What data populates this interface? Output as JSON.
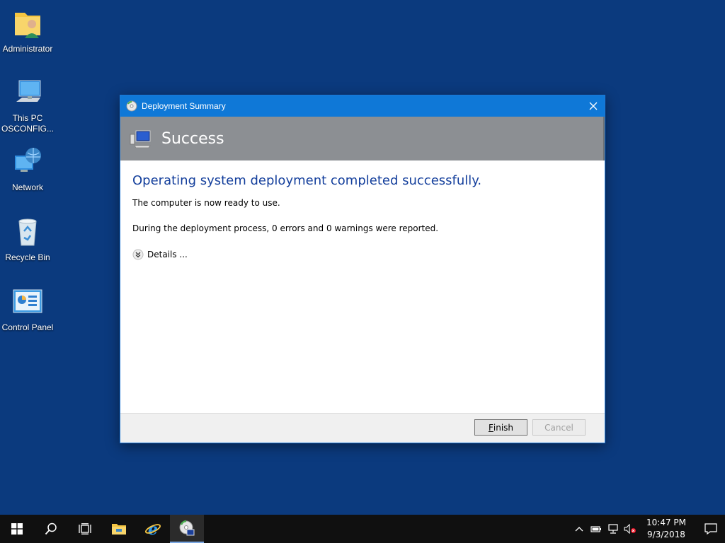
{
  "desktop": {
    "icons": [
      {
        "label": "Administrator",
        "icon": "user-folder-icon"
      },
      {
        "label": "This PC\nOSCONFIG...",
        "icon": "this-pc-icon"
      },
      {
        "label": "Network",
        "icon": "network-icon"
      },
      {
        "label": "Recycle Bin",
        "icon": "recycle-bin-icon"
      },
      {
        "label": "Control Panel",
        "icon": "control-panel-icon"
      }
    ]
  },
  "dialog": {
    "title": "Deployment Summary",
    "header": "Success",
    "headline": "Operating system deployment completed successfully.",
    "ready_text": "The computer is now ready to use.",
    "summary_text": "During the deployment process, 0 errors and 0 warnings were reported.",
    "details_label": "Details ...",
    "finish_label_underlined": "F",
    "finish_label_rest": "inish",
    "cancel_label": "Cancel",
    "colors": {
      "titlebar": "#0f78d7",
      "header_band": "#8c8f93",
      "headline": "#143f9c"
    }
  },
  "taskbar": {
    "items": [
      "start-icon",
      "search-icon",
      "task-view-icon",
      "file-explorer-icon",
      "internet-explorer-icon",
      "deployment-app-icon"
    ],
    "tray": [
      "chevron-up-icon",
      "power-icon",
      "network-icon",
      "volume-muted-icon"
    ],
    "time": "10:47 PM",
    "date": "9/3/2018"
  }
}
